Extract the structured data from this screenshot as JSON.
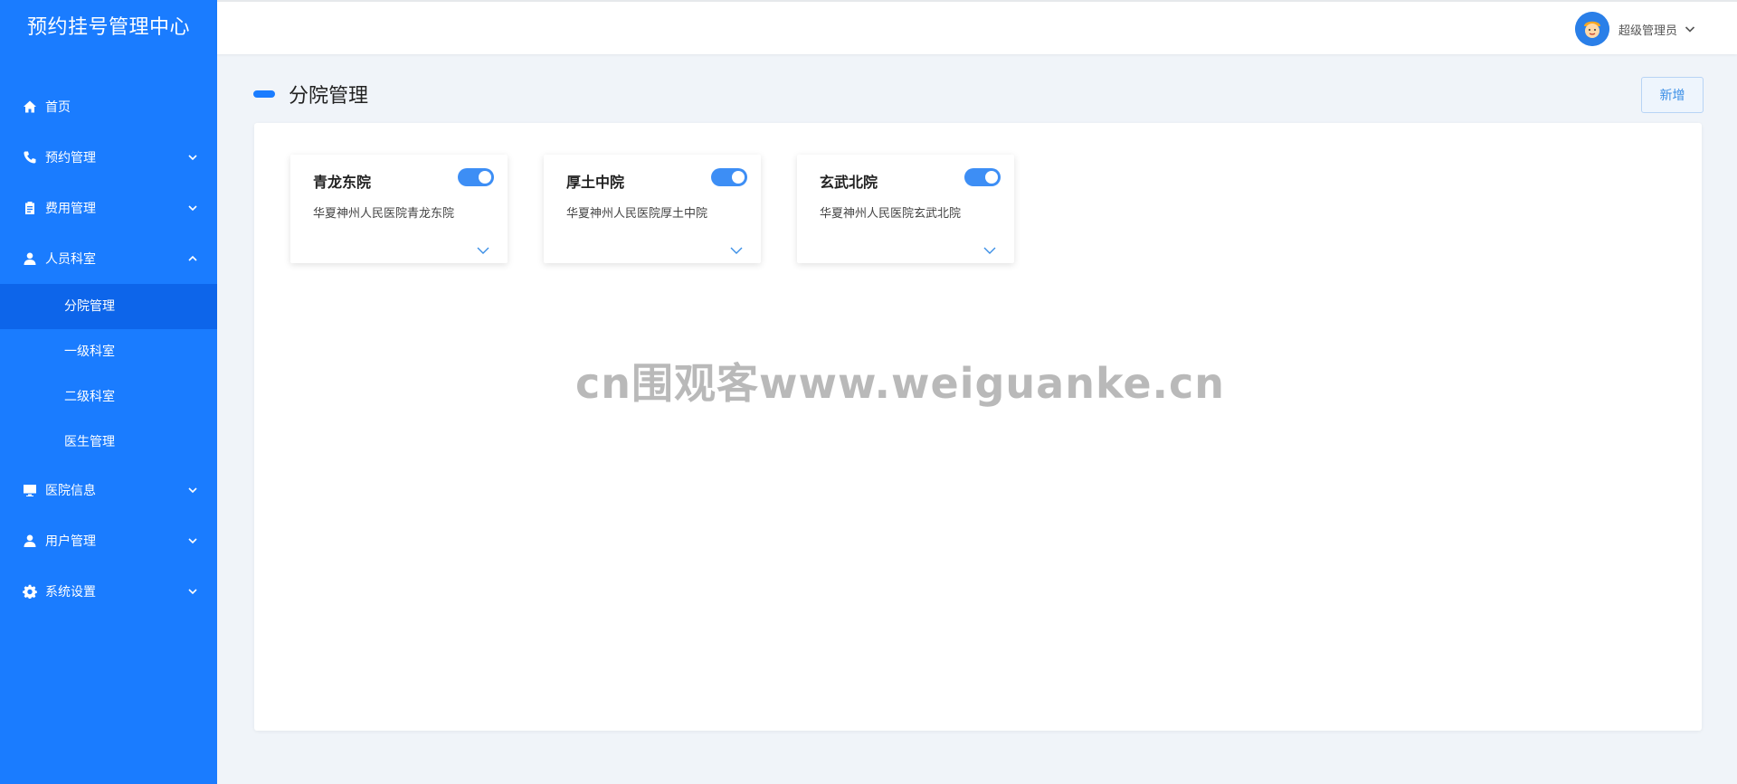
{
  "app": {
    "title": "预约挂号管理中心"
  },
  "sidebar": {
    "items": [
      {
        "label": "首页",
        "icon": "home-icon",
        "expandable": false
      },
      {
        "label": "预约管理",
        "icon": "phone-icon",
        "expandable": true,
        "expanded": false
      },
      {
        "label": "费用管理",
        "icon": "clipboard-icon",
        "expandable": true,
        "expanded": false
      },
      {
        "label": "人员科室",
        "icon": "person-icon",
        "expandable": true,
        "expanded": true,
        "children": [
          {
            "label": "分院管理",
            "active": true
          },
          {
            "label": "一级科室"
          },
          {
            "label": "二级科室"
          },
          {
            "label": "医生管理"
          }
        ]
      },
      {
        "label": "医院信息",
        "icon": "monitor-icon",
        "expandable": true,
        "expanded": false
      },
      {
        "label": "用户管理",
        "icon": "person-icon",
        "expandable": true,
        "expanded": false
      },
      {
        "label": "系统设置",
        "icon": "gear-icon",
        "expandable": true,
        "expanded": false
      }
    ]
  },
  "header": {
    "user_name": "超级管理员"
  },
  "page": {
    "title": "分院管理",
    "add_label": "新增"
  },
  "branches": [
    {
      "name": "青龙东院",
      "desc": "华夏神州人民医院青龙东院",
      "enabled": true
    },
    {
      "name": "厚土中院",
      "desc": "华夏神州人民医院厚土中院",
      "enabled": true
    },
    {
      "name": "玄武北院",
      "desc": "华夏神州人民医院玄武北院",
      "enabled": true
    }
  ],
  "watermark": "cn围观客www.weiguanke.cn",
  "colors": {
    "sidebar": "#1a7cff",
    "sidebar_active": "#0d65ea",
    "accent": "#3d8ef5",
    "background": "#f0f4f9"
  }
}
